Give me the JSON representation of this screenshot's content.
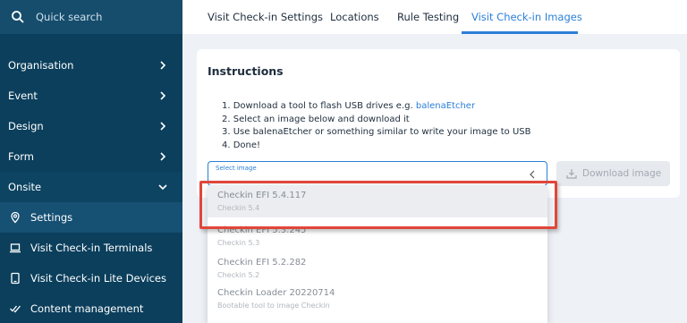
{
  "search": {
    "placeholder": "Quick search"
  },
  "sidebar": {
    "items": [
      {
        "label": "Organisation"
      },
      {
        "label": "Event"
      },
      {
        "label": "Design"
      },
      {
        "label": "Form"
      },
      {
        "label": "Onsite"
      }
    ],
    "subitems": [
      {
        "label": "Settings",
        "icon": "location-pin-icon"
      },
      {
        "label": "Visit Check-in Terminals",
        "icon": "laptop-icon"
      },
      {
        "label": "Visit Check-in Lite Devices",
        "icon": "tablet-icon"
      },
      {
        "label": "Content management",
        "icon": "checks-icon"
      }
    ]
  },
  "tabs": [
    {
      "label": "Visit Check-in Settings"
    },
    {
      "label": "Locations"
    },
    {
      "label": "Rule Testing"
    },
    {
      "label": "Visit Check-in Images",
      "active": true
    }
  ],
  "instructions": {
    "title": "Instructions",
    "step1_prefix": "1. Download a tool to flash USB drives e.g. ",
    "step1_link": "balenaEtcher",
    "step2": "2. Select an image below and download it",
    "step3": "3. Use balenaEtcher or something similar to write your image to USB",
    "step4": "4. Done!"
  },
  "select": {
    "label": "Select image"
  },
  "download_button": {
    "label": "Download image"
  },
  "options": [
    {
      "name": "Checkin EFI 5.4.117",
      "desc": "Checkin 5.4"
    },
    {
      "name": "Checkin EFI 5.3.245",
      "desc": "Checkin 5.3"
    },
    {
      "name": "Checkin EFI 5.2.282",
      "desc": "Checkin 5.2"
    },
    {
      "name": "Checkin Loader 20220714",
      "desc": "Bootable tool to image Checkin"
    }
  ],
  "colors": {
    "sidebar": "#0b3f5c",
    "accent": "#2b7fd8",
    "highlight": "#e0463a"
  }
}
